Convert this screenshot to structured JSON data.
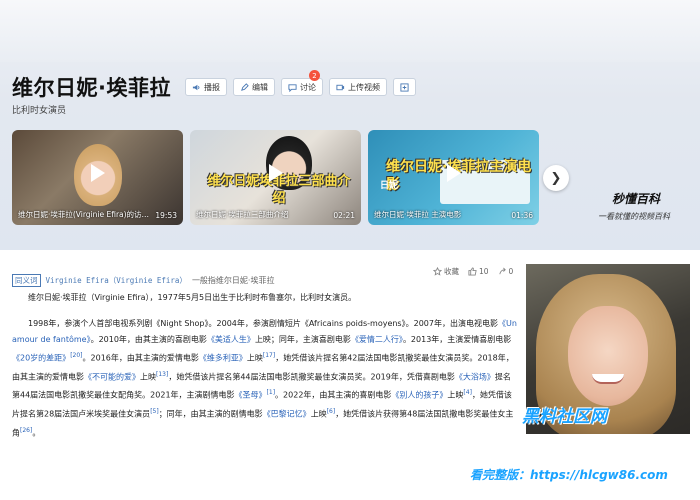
{
  "entry": {
    "title": "维尔日妮·埃菲拉",
    "subtitle": "比利时女演员",
    "actions": [
      {
        "label": "播报",
        "icon": "speaker-icon"
      },
      {
        "label": "编辑",
        "icon": "pencil-icon"
      },
      {
        "label": "讨论",
        "icon": "chat-icon",
        "badge": "2"
      },
      {
        "label": "上传视频",
        "icon": "video-upload-icon"
      },
      {
        "label": "",
        "icon": "plus-icon"
      }
    ]
  },
  "videos": [
    {
      "title": "维尔日妮·埃菲拉(Virginie Efira)的访…",
      "duration": "19:53",
      "overlay": ""
    },
    {
      "title": "维尔日妮·埃菲拉三部曲介绍",
      "duration": "02:21",
      "overlay": "维尔日妮埃菲拉三部曲介绍"
    },
    {
      "title": "维尔日妮·埃菲拉 主演电影",
      "duration": "01:36",
      "overlay": "维尔日妮·埃菲拉主演电影",
      "logo": "日妮"
    }
  ],
  "brand": {
    "name": "秒懂百科",
    "slogan": "一看就懂的视频百科"
  },
  "synonym": {
    "tag": "同义词",
    "alt_name": "Virginie Efira（Virginie Efira）",
    "text": "一般指维尔日妮·埃菲拉"
  },
  "meta": {
    "collect_label": "收藏",
    "likes": "10",
    "shares": "0"
  },
  "summary": "维尔日妮·埃菲拉（Virginie Efira），1977年5月5日出生于比利时布鲁塞尔，比利时女演员。",
  "body": {
    "seg1": "1998年，参演个人首部电视系列剧《Night Shop》。2004年，参演剧情短片《Africains poids-moyens》。2007年，出演电视电影",
    "link1": "《Un amour de fantôme》",
    "seg2": "。2010年，由其主演的喜剧电影",
    "link2": "《美适人生》",
    "seg3": "上映；同年，主演喜剧电影",
    "link3": "《爱情二人行》",
    "seg4": "。2013年，主演爱情喜剧电影",
    "link4": "《20岁的差距》",
    "ref1": "[20]",
    "seg5": "。2016年，由其主演的爱情电影",
    "link5": "《维多利亚》",
    "seg6": "上映",
    "ref2": "[17]",
    "seg7": "，她凭借该片提名第42届法国电影凯撒奖最佳女演员奖。2018年，由其主演的爱情电影",
    "link6": "《不可能的爱》",
    "seg8": "上映",
    "ref3": "[13]",
    "seg9": "，她凭借该片提名第44届法国电影凯撒奖最佳女演员奖。2019年，凭借喜剧电影",
    "link7": "《大浴场》",
    "seg10": "提名第44届法国电影凯撒奖最佳女配角奖。2021年，主演剧情电影",
    "link8": "《圣母》",
    "ref4": "[1]",
    "seg11": "。2022年，由其主演的喜剧电影",
    "link9": "《别人的孩子》",
    "seg12": "上映",
    "ref5": "[4]",
    "seg13": "，她凭借该片提名第28届法国卢米埃奖最佳女演员",
    "ref6": "[5]",
    "seg14": "；同年，由其主演的剧情电影",
    "link10": "《巴黎记忆》",
    "seg15": "上映",
    "ref7": "[6]",
    "seg16": "，她凭借该片获得第48届法国凯撒电影奖最佳女主角",
    "ref8": "[26]",
    "seg17": "。"
  },
  "watermark": {
    "site_name": "黑料社区网",
    "url_text": "看完整版：https://hlcgw86.com"
  }
}
